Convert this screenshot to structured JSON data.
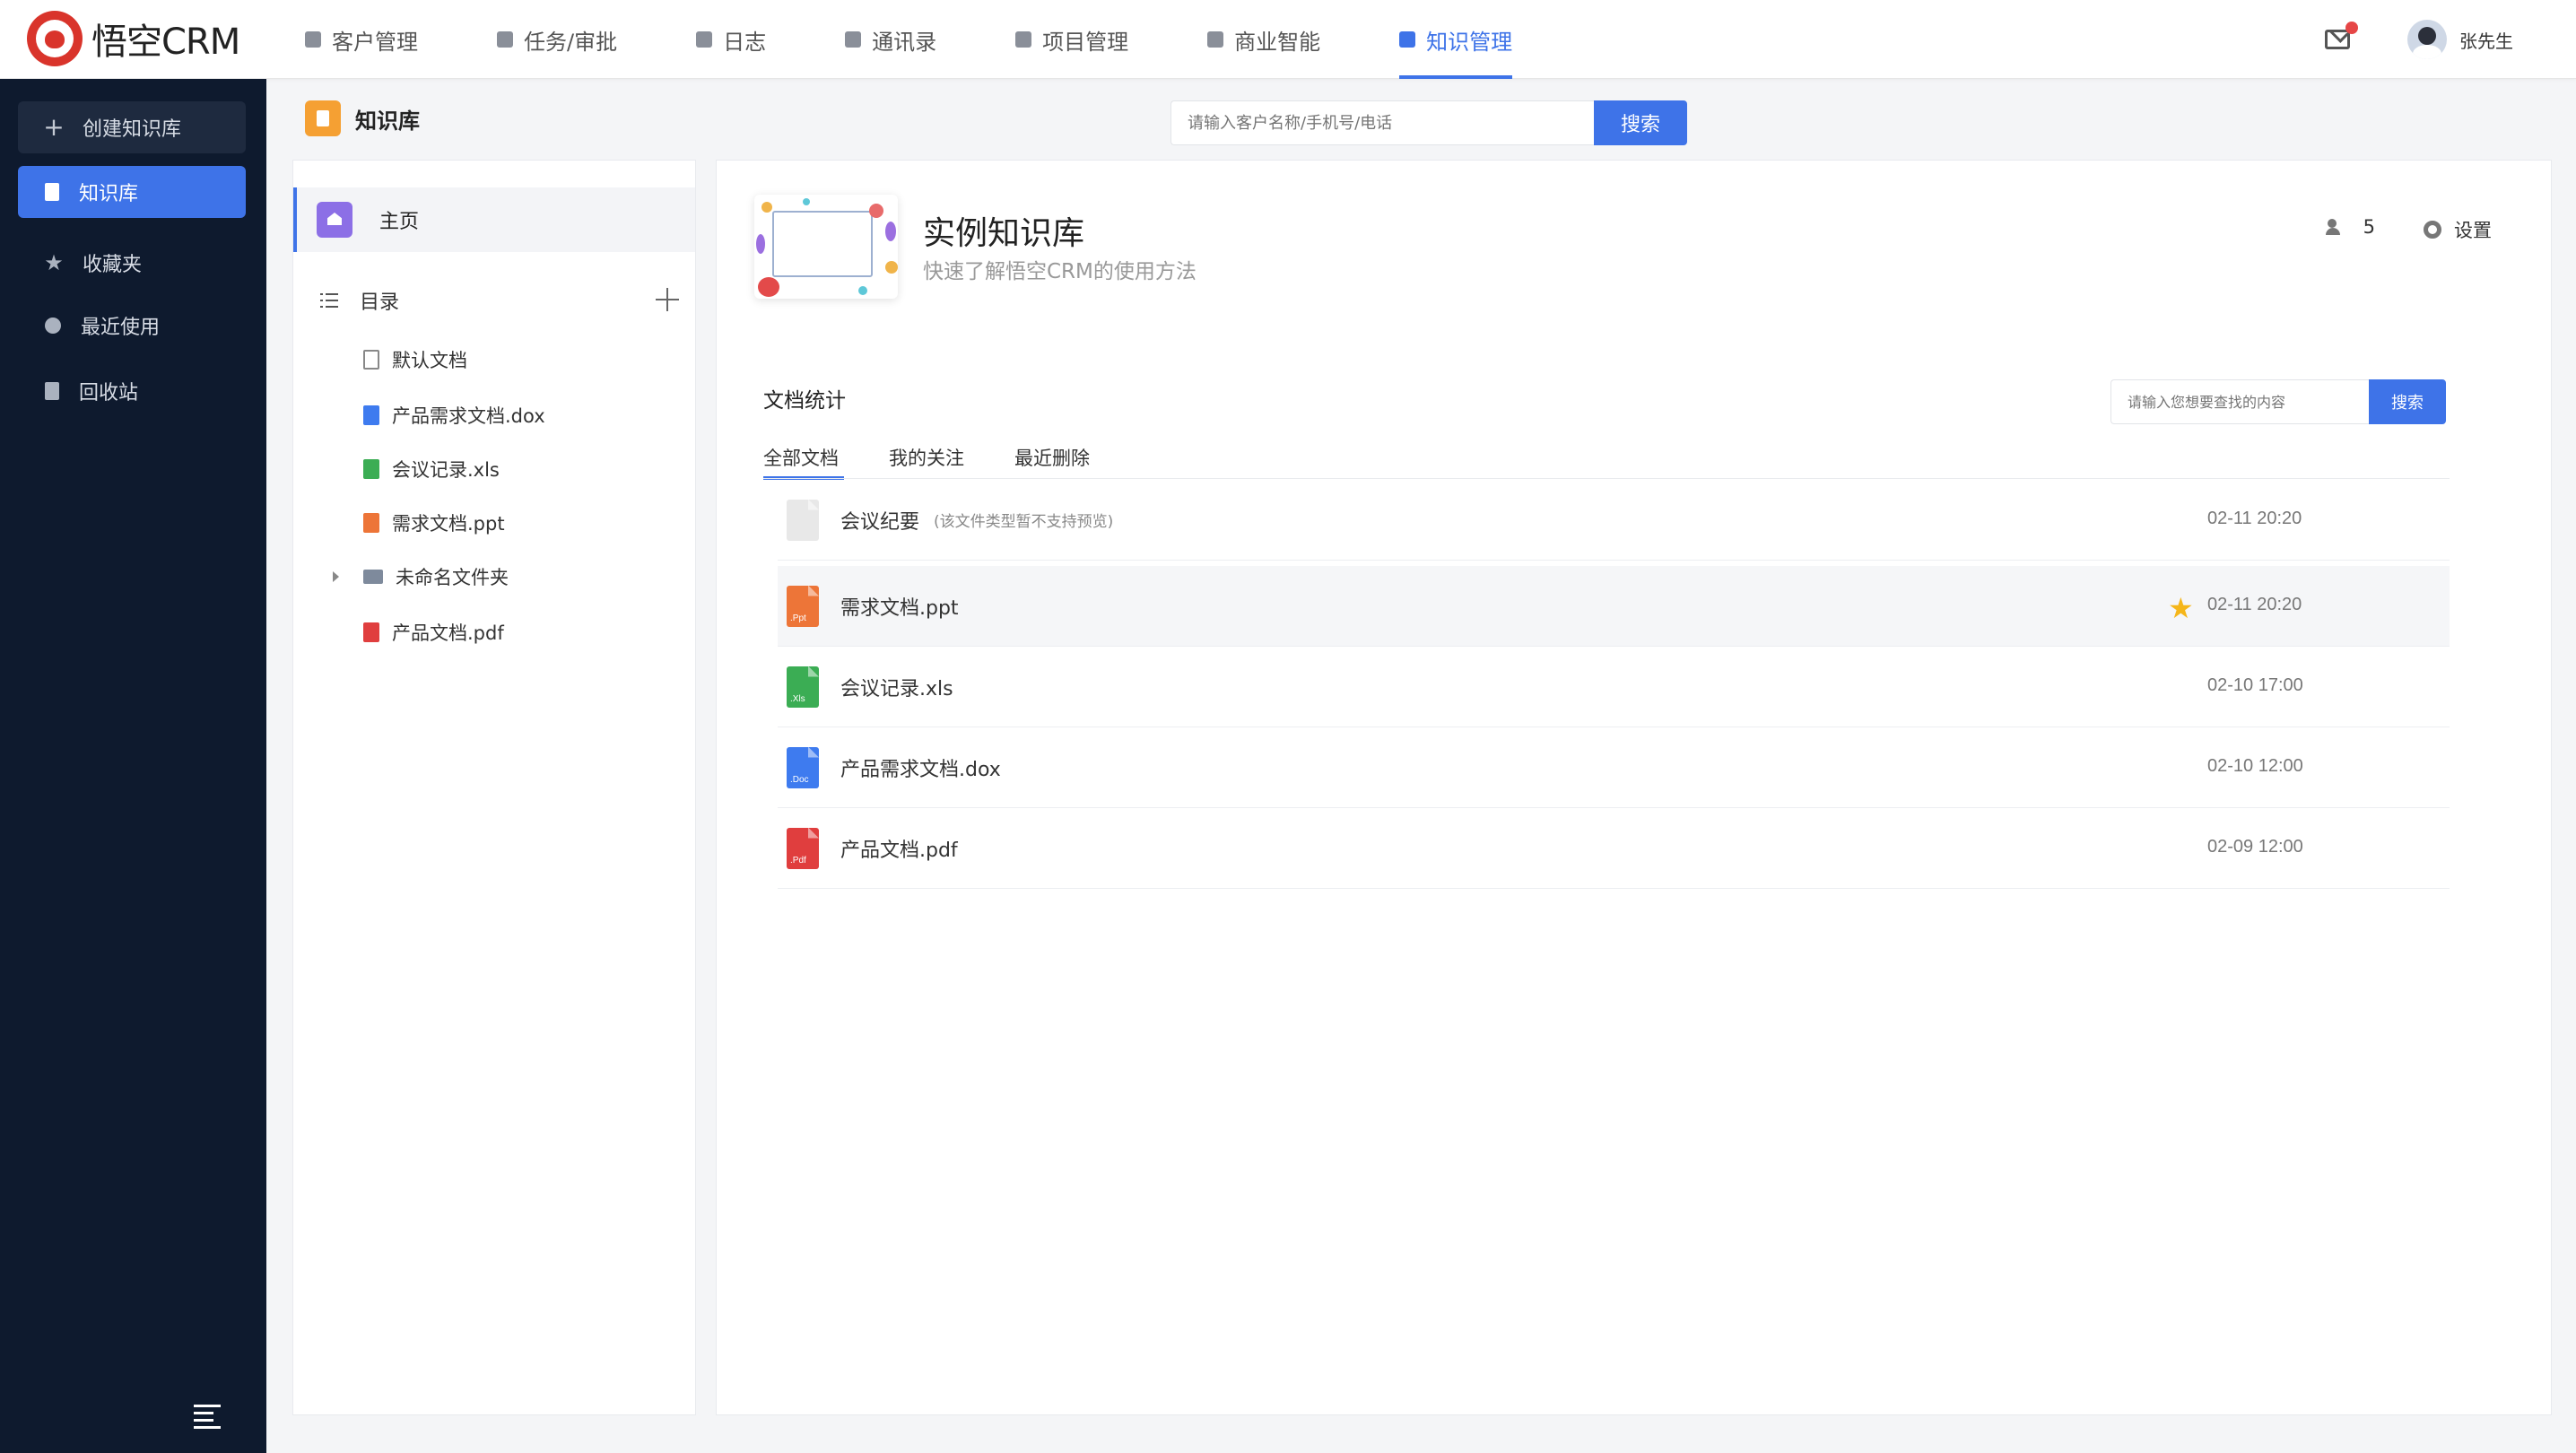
{
  "app": {
    "logo_text": "悟空CRM",
    "user_name": "张先生",
    "accent_color": "#3e73e8",
    "sidebar_color": "#0e1a2e"
  },
  "nav": {
    "items": [
      {
        "label": "客户管理",
        "icon": "building-icon",
        "active": false
      },
      {
        "label": "任务/审批",
        "icon": "briefcase-icon",
        "active": false
      },
      {
        "label": "日志",
        "icon": "log-icon",
        "active": false
      },
      {
        "label": "通讯录",
        "icon": "contacts-icon",
        "active": false
      },
      {
        "label": "项目管理",
        "icon": "project-icon",
        "active": false
      },
      {
        "label": "商业智能",
        "icon": "bi-icon",
        "active": false
      },
      {
        "label": "知识管理",
        "icon": "knowledge-icon",
        "active": true
      }
    ]
  },
  "sidebar": {
    "create_label": "创建知识库",
    "items": [
      {
        "label": "知识库",
        "icon": "book-icon",
        "active": true
      },
      {
        "label": "收藏夹",
        "icon": "star-icon",
        "active": false
      },
      {
        "label": "最近使用",
        "icon": "clock-icon",
        "active": false
      },
      {
        "label": "回收站",
        "icon": "trash-icon",
        "active": false
      }
    ]
  },
  "page": {
    "title": "知识库",
    "search_placeholder": "请输入客户名称/手机号/电话",
    "search_button": "搜索"
  },
  "tree": {
    "home_label": "主页",
    "directory_label": "目录",
    "items": [
      {
        "label": "默认文档",
        "type": "default"
      },
      {
        "label": "产品需求文档.dox",
        "type": "doc"
      },
      {
        "label": "会议记录.xls",
        "type": "xls"
      },
      {
        "label": "需求文档.ppt",
        "type": "ppt"
      },
      {
        "label": "未命名文件夹",
        "type": "folder"
      },
      {
        "label": "产品文档.pdf",
        "type": "pdf"
      }
    ]
  },
  "kb": {
    "title": "实例知识库",
    "subtitle": "快速了解悟空CRM的使用方法",
    "member_count": "5",
    "settings_label": "设置"
  },
  "docs": {
    "section_title": "文档统计",
    "search_placeholder": "请输入您想要查找的内容",
    "search_button": "搜索",
    "tabs": [
      "全部文档",
      "我的关注",
      "最近删除"
    ],
    "rows": [
      {
        "name": "会议纪要",
        "note": "(该文件类型暂不支持预览)",
        "time": "02-11 20:20",
        "type": "none",
        "tag": "",
        "starred": false
      },
      {
        "name": "需求文档.ppt",
        "note": "",
        "time": "02-11 20:20",
        "type": "ppt",
        "tag": ".Ppt",
        "starred": true
      },
      {
        "name": "会议记录.xls",
        "note": "",
        "time": "02-10 17:00",
        "type": "xls",
        "tag": ".Xls",
        "starred": false
      },
      {
        "name": "产品需求文档.dox",
        "note": "",
        "time": "02-10 12:00",
        "type": "doc",
        "tag": ".Doc",
        "starred": false
      },
      {
        "name": "产品文档.pdf",
        "note": "",
        "time": "02-09 12:00",
        "type": "pdf",
        "tag": ".Pdf",
        "starred": false
      }
    ]
  }
}
